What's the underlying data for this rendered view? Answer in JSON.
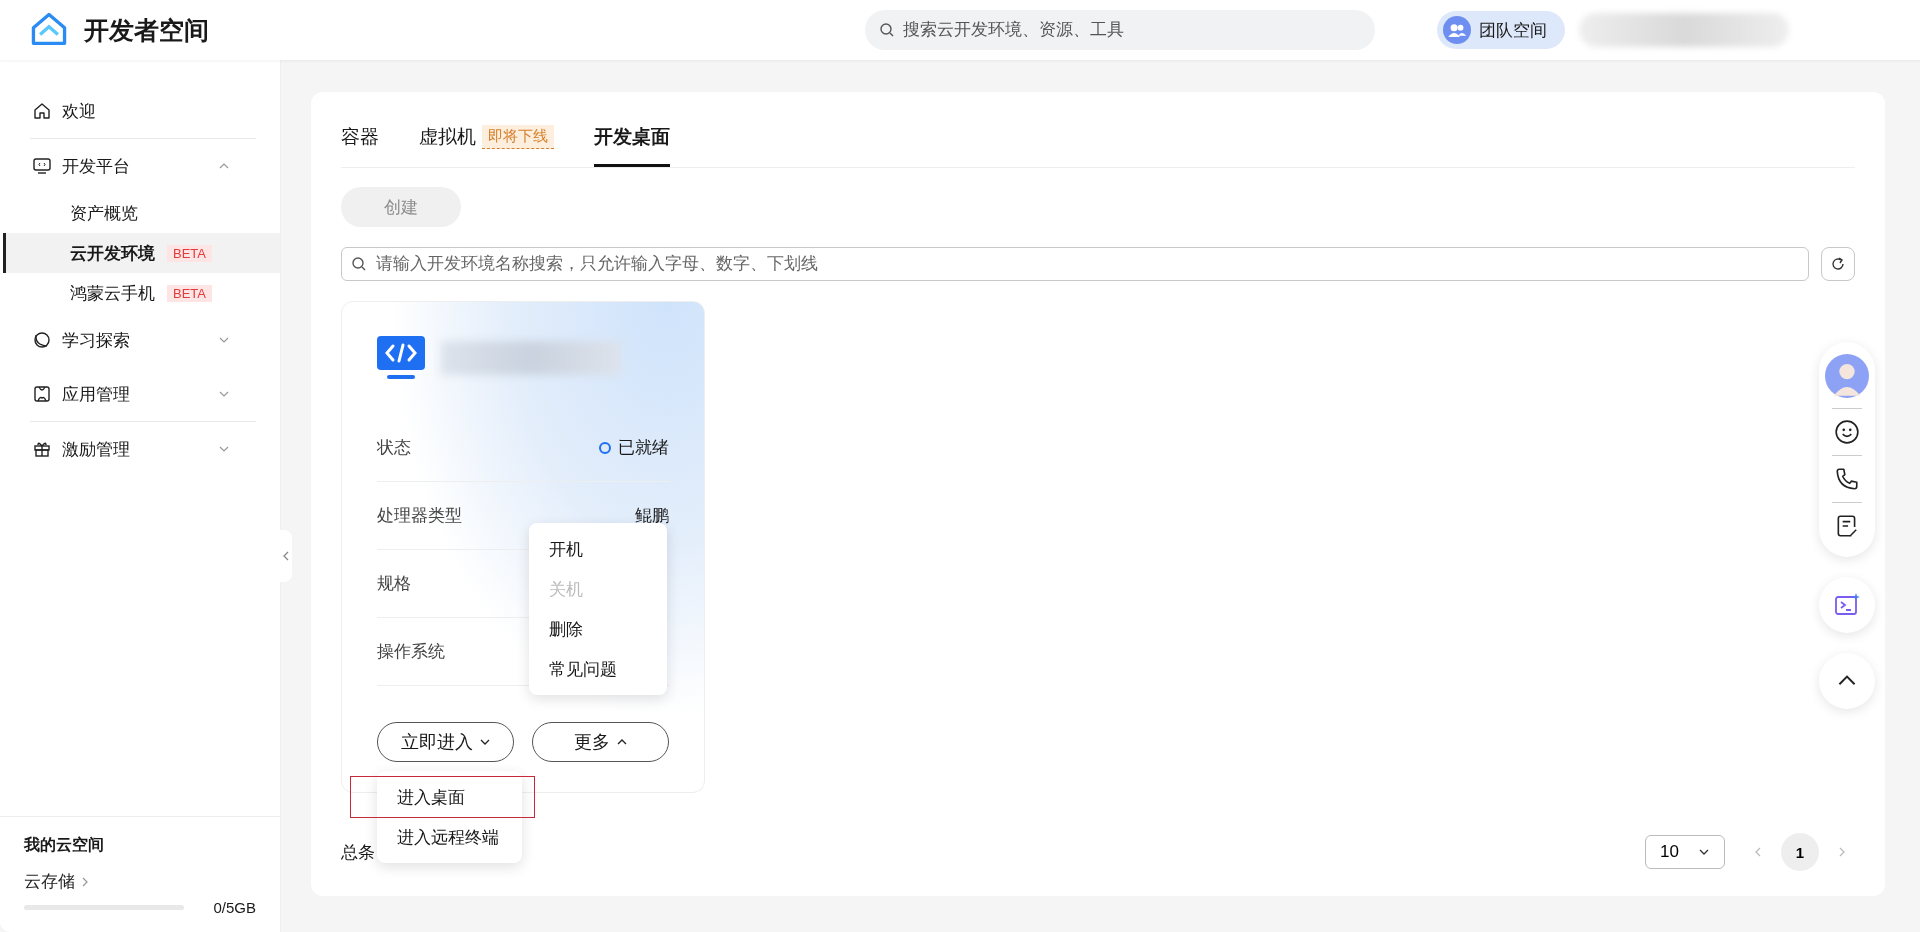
{
  "header": {
    "title": "开发者空间",
    "search": {
      "placeholder": "搜索云开发环境、资源、工具"
    },
    "team_button": "团队空间"
  },
  "sidebar": {
    "items": [
      {
        "label": "欢迎",
        "selected": false
      },
      {
        "label": "开发平台",
        "selected": false,
        "expanded": true,
        "children": [
          {
            "label": "资产概览",
            "selected": false
          },
          {
            "label": "云开发环境",
            "selected": true,
            "badge": "BETA"
          },
          {
            "label": "鸿蒙云手机",
            "selected": false,
            "badge": "BETA"
          }
        ]
      },
      {
        "label": "学习探索",
        "selected": false,
        "expanded": false
      },
      {
        "label": "应用管理",
        "selected": false,
        "expanded": false
      },
      {
        "label": "激励管理",
        "selected": false,
        "expanded": false
      }
    ],
    "storage": {
      "title": "我的云空间",
      "link": "云存储",
      "level": 0,
      "usage": "0/5GB"
    }
  },
  "tabs": [
    {
      "label": "容器",
      "selected": false
    },
    {
      "label": "虚拟机",
      "selected": false,
      "badge": "即将下线"
    },
    {
      "label": "开发桌面",
      "selected": true
    }
  ],
  "create_button": {
    "label": "创建",
    "disabled": true
  },
  "filter": {
    "placeholder": "请输入开发环境名称搜索，只允许输入字母、数字、下划线"
  },
  "card": {
    "rows": [
      {
        "label": "状态",
        "value": "已就绪",
        "kind": "status"
      },
      {
        "label": "处理器类型",
        "value": "鲲鹏",
        "kind": "text"
      },
      {
        "label": "规格"
      },
      {
        "label": "操作系统"
      }
    ],
    "actions": [
      {
        "label": "立即进入",
        "expanded": false
      },
      {
        "label": "更多",
        "expanded": true
      }
    ],
    "more_menu": [
      {
        "label": "开机",
        "disabled": false
      },
      {
        "label": "关机",
        "disabled": true
      },
      {
        "label": "删除",
        "disabled": false
      },
      {
        "label": "常见问题",
        "disabled": false
      }
    ],
    "enter_menu": [
      {
        "label": "进入桌面",
        "selected": true
      },
      {
        "label": "进入远程终端",
        "selected": false
      }
    ]
  },
  "total_label": "总条",
  "pagination": {
    "page_size": "10",
    "pages": [
      {
        "label": "1",
        "selected": true
      }
    ]
  }
}
